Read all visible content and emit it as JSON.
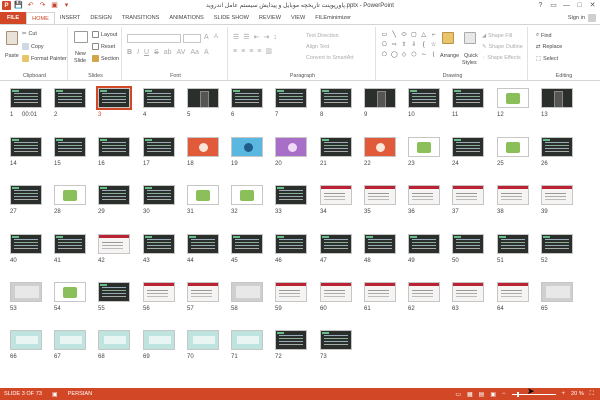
{
  "window": {
    "title": "پاورپوینت تاریخچه موبایل و پیدایش سیستم عامل اندروید.pptx - PowerPoint",
    "controls": [
      "?",
      "▭",
      "—",
      "□",
      "✕"
    ]
  },
  "qat": {
    "logo": "P",
    "save": "💾",
    "undo": "↶",
    "redo": "↷",
    "present": "▣",
    "more": "▾"
  },
  "tabs": [
    "FILE",
    "HOME",
    "INSERT",
    "DESIGN",
    "TRANSITIONS",
    "ANIMATIONS",
    "SLIDE SHOW",
    "REVIEW",
    "VIEW",
    "FILEminimizer"
  ],
  "active_tab": "HOME",
  "signin": "Sign in",
  "ribbon": {
    "clipboard": {
      "label": "Clipboard",
      "paste": "Paste",
      "cut": "Cut",
      "copy": "Copy",
      "format_painter": "Format Painter"
    },
    "slides": {
      "label": "Slides",
      "new_slide": "New",
      "new_slide2": "Slide",
      "layout": "Layout",
      "reset": "Reset",
      "section": "Section"
    },
    "font": {
      "label": "Font"
    },
    "paragraph": {
      "label": "Paragraph",
      "text_direction": "Text Direction",
      "align_text": "Align Text",
      "convert": "Convert to SmartArt"
    },
    "drawing": {
      "label": "Drawing",
      "arrange": "Arrange",
      "quick_styles": "Quick",
      "quick_styles2": "Styles",
      "shape_fill": "Shape Fill",
      "shape_outline": "Shape Outline",
      "shape_effects": "Shape Effects"
    },
    "editing": {
      "label": "Editing",
      "find": "Find",
      "replace": "Replace",
      "select": "Select"
    }
  },
  "shape_glyphs": [
    "▭",
    "╲",
    "⬭",
    "▢",
    "△",
    "⌐",
    "⎔",
    "⇨",
    "⇧",
    "⇩",
    "{",
    "☆",
    "⬠",
    "◯",
    "◇",
    "⬡",
    "∼",
    "⟨"
  ],
  "slides": [
    {
      "n": "1",
      "t": "dark",
      "time": "00:01"
    },
    {
      "n": "2",
      "t": "dark"
    },
    {
      "n": "3",
      "t": "dark",
      "selected": true
    },
    {
      "n": "4",
      "t": "dark"
    },
    {
      "n": "5",
      "t": "phone"
    },
    {
      "n": "6",
      "t": "dark"
    },
    {
      "n": "7",
      "t": "dark"
    },
    {
      "n": "8",
      "t": "dark"
    },
    {
      "n": "9",
      "t": "phone"
    },
    {
      "n": "10",
      "t": "dark"
    },
    {
      "n": "11",
      "t": "dark"
    },
    {
      "n": "12",
      "t": "white"
    },
    {
      "n": "13",
      "t": "phone"
    },
    {
      "n": "14",
      "t": "dark"
    },
    {
      "n": "15",
      "t": "dark"
    },
    {
      "n": "16",
      "t": "dark"
    },
    {
      "n": "17",
      "t": "dark"
    },
    {
      "n": "18",
      "t": "red"
    },
    {
      "n": "19",
      "t": "blue"
    },
    {
      "n": "20",
      "t": "purple"
    },
    {
      "n": "21",
      "t": "dark"
    },
    {
      "n": "22",
      "t": "red"
    },
    {
      "n": "23",
      "t": "white"
    },
    {
      "n": "24",
      "t": "dark"
    },
    {
      "n": "25",
      "t": "white"
    },
    {
      "n": "26",
      "t": "dark"
    },
    {
      "n": "27",
      "t": "dark"
    },
    {
      "n": "28",
      "t": "white"
    },
    {
      "n": "29",
      "t": "dark"
    },
    {
      "n": "30",
      "t": "dark"
    },
    {
      "n": "31",
      "t": "white"
    },
    {
      "n": "32",
      "t": "white"
    },
    {
      "n": "33",
      "t": "dark"
    },
    {
      "n": "34",
      "t": "light"
    },
    {
      "n": "35",
      "t": "light"
    },
    {
      "n": "36",
      "t": "light"
    },
    {
      "n": "37",
      "t": "light"
    },
    {
      "n": "38",
      "t": "light"
    },
    {
      "n": "39",
      "t": "light"
    },
    {
      "n": "40",
      "t": "dark"
    },
    {
      "n": "41",
      "t": "dark"
    },
    {
      "n": "42",
      "t": "light"
    },
    {
      "n": "43",
      "t": "dark"
    },
    {
      "n": "44",
      "t": "dark"
    },
    {
      "n": "45",
      "t": "dark"
    },
    {
      "n": "46",
      "t": "dark"
    },
    {
      "n": "47",
      "t": "dark"
    },
    {
      "n": "48",
      "t": "dark"
    },
    {
      "n": "49",
      "t": "dark"
    },
    {
      "n": "50",
      "t": "dark"
    },
    {
      "n": "51",
      "t": "dark"
    },
    {
      "n": "52",
      "t": "dark"
    },
    {
      "n": "53",
      "t": "gray"
    },
    {
      "n": "54",
      "t": "white"
    },
    {
      "n": "55",
      "t": "dark"
    },
    {
      "n": "56",
      "t": "light"
    },
    {
      "n": "57",
      "t": "light"
    },
    {
      "n": "58",
      "t": "gray"
    },
    {
      "n": "59",
      "t": "light"
    },
    {
      "n": "60",
      "t": "light"
    },
    {
      "n": "61",
      "t": "light"
    },
    {
      "n": "62",
      "t": "light"
    },
    {
      "n": "63",
      "t": "light"
    },
    {
      "n": "64",
      "t": "light"
    },
    {
      "n": "65",
      "t": "gray"
    },
    {
      "n": "66",
      "t": "teal"
    },
    {
      "n": "67",
      "t": "teal"
    },
    {
      "n": "68",
      "t": "teal"
    },
    {
      "n": "69",
      "t": "teal"
    },
    {
      "n": "70",
      "t": "teal"
    },
    {
      "n": "71",
      "t": "teal"
    },
    {
      "n": "72",
      "t": "dark"
    },
    {
      "n": "73",
      "t": "dark"
    }
  ],
  "status": {
    "slide": "SLIDE 3 OF 73",
    "lang": "PERSIAN",
    "zoom": "20 %"
  },
  "colors": {
    "accent": "#d24726"
  }
}
